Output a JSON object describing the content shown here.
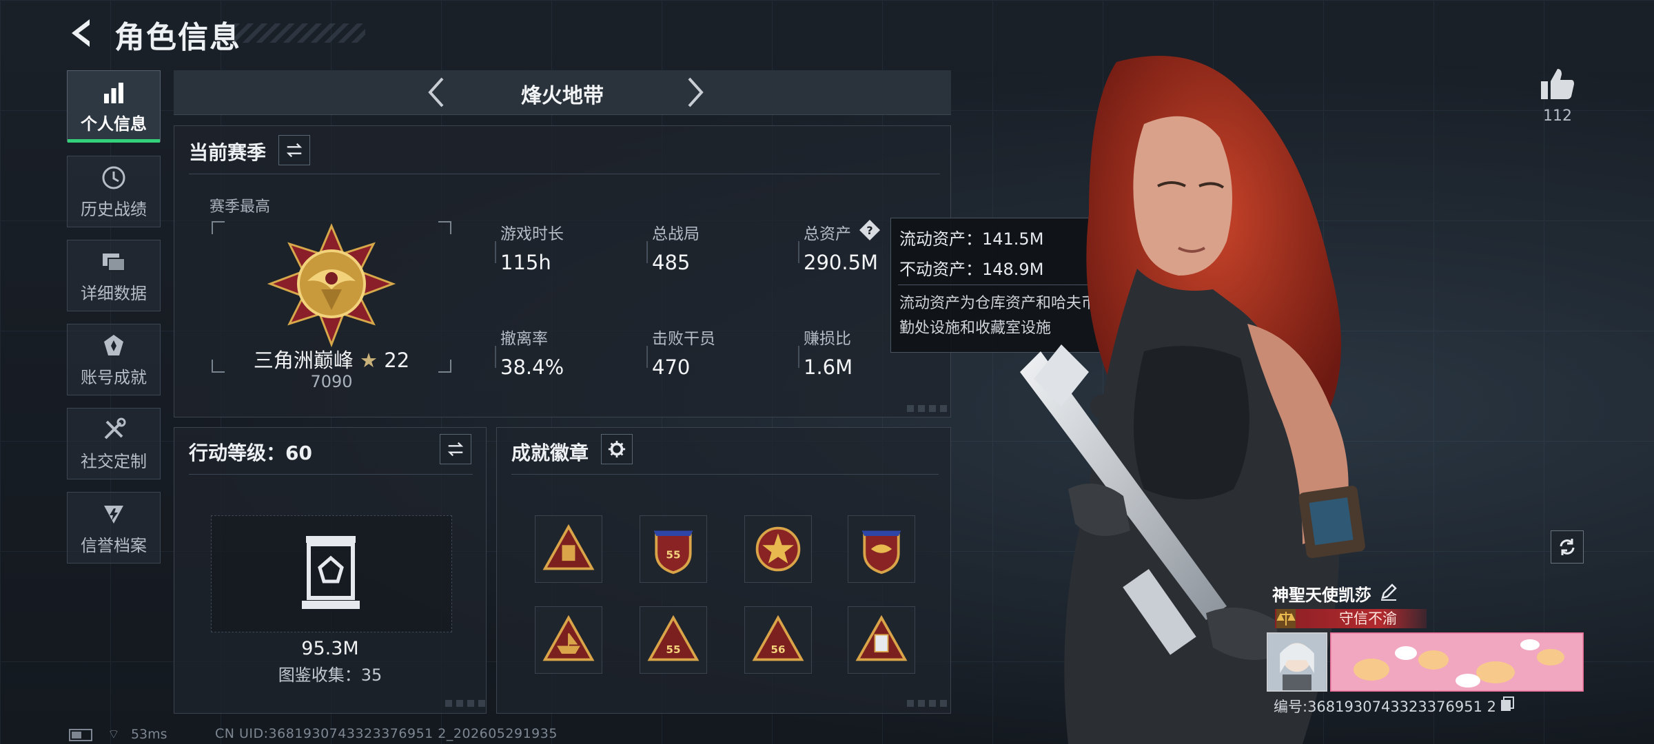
{
  "header": {
    "title": "角色信息"
  },
  "sidebar": {
    "items": [
      {
        "label": "个人信息",
        "icon": "bar-chart-icon",
        "active": true
      },
      {
        "label": "历史战绩",
        "icon": "history-icon",
        "active": false
      },
      {
        "label": "详细数据",
        "icon": "cards-icon",
        "active": false
      },
      {
        "label": "账号成就",
        "icon": "achievement-icon",
        "active": false
      },
      {
        "label": "社交定制",
        "icon": "tools-icon",
        "active": false
      },
      {
        "label": "信誉档案",
        "icon": "reputation-icon",
        "active": false
      }
    ]
  },
  "mode": {
    "title": "烽火地带"
  },
  "season": {
    "title": "当前赛季",
    "subtitle": "赛季最高",
    "rank_name": "三角洲巅峰",
    "rank_stars": "22",
    "rank_score": "7090",
    "stats": [
      {
        "label": "游戏时长",
        "value": "115h"
      },
      {
        "label": "总战局",
        "value": "485"
      },
      {
        "label": "总资产",
        "value": "290.5M"
      },
      {
        "label": "撤离率",
        "value": "38.4%"
      },
      {
        "label": "击败干员",
        "value": "470"
      },
      {
        "label": "赚损比",
        "value": "1.6M"
      }
    ]
  },
  "tooltip": {
    "liquid": "流动资产：141.5M",
    "fixed": "不动资产：148.9M",
    "note": "流动资产为仓库资产和哈夫币，不动资产为特勤处设施和收藏室设施"
  },
  "action": {
    "title": "行动等级：60",
    "codex_value": "95.3M",
    "codex_count": "图鉴收集：35"
  },
  "badges": {
    "title": "成就徽章",
    "items": [
      {
        "icon": "triangle-bag-badge-icon"
      },
      {
        "icon": "crest-55-badge-icon"
      },
      {
        "icon": "star-round-badge-icon"
      },
      {
        "icon": "crest-wings-badge-icon"
      },
      {
        "icon": "triangle-boat-badge-icon"
      },
      {
        "icon": "triangle-55-badge-icon"
      },
      {
        "icon": "triangle-56-badge-icon"
      },
      {
        "icon": "triangle-card-badge-icon"
      }
    ]
  },
  "profile": {
    "likes": "112",
    "player_name": "神聖天使凯莎",
    "motto": "守信不渝",
    "player_id": "编号:3681930743323376951 2"
  },
  "status": {
    "ping": "53ms",
    "uid": "CN UID:3681930743323376951 2_202605291935"
  },
  "colors": {
    "accent_green": "#33d17a",
    "motto_red": "#b12a2e",
    "background": "#161b22"
  }
}
